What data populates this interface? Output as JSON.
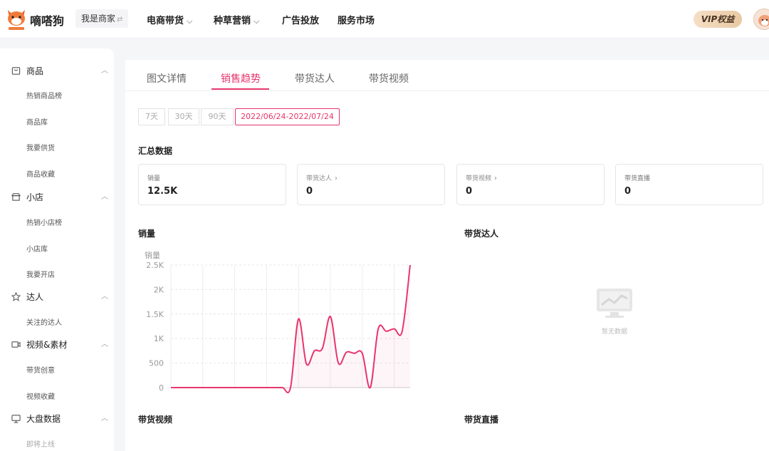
{
  "header": {
    "brand": "嘀嗒狗",
    "merchant_switch": "我是商家",
    "nav": [
      {
        "label": "电商带货",
        "has_dropdown": true
      },
      {
        "label": "种草营销",
        "has_dropdown": true
      },
      {
        "label": "广告投放",
        "has_dropdown": false
      },
      {
        "label": "服务市场",
        "has_dropdown": false
      }
    ],
    "vip_label": "VIP权益"
  },
  "sidebar": {
    "sections": [
      {
        "label": "商品",
        "icon": "shopping-bag-icon",
        "items": [
          "热销商品榜",
          "商品库",
          "我要供货",
          "商品收藏"
        ]
      },
      {
        "label": "小店",
        "icon": "store-icon",
        "items": [
          "热销小店榜",
          "小店库",
          "我要开店"
        ]
      },
      {
        "label": "达人",
        "icon": "star-icon",
        "items": [
          "关注的达人"
        ]
      },
      {
        "label": "视频&素材",
        "icon": "video-camera-icon",
        "items": [
          "带货创意",
          "视频收藏"
        ]
      },
      {
        "label": "大盘数据",
        "icon": "dashboard-icon",
        "items": [
          "即将上线"
        ]
      }
    ]
  },
  "tabs": [
    "图文详情",
    "销售趋势",
    "带货达人",
    "带货视频"
  ],
  "active_tab": "销售趋势",
  "date_ranges": [
    "7天",
    "30天",
    "90天",
    "2022/06/24-2022/07/24"
  ],
  "active_range": "2022/06/24-2022/07/24",
  "summary": {
    "title": "汇总数据",
    "cards": [
      {
        "label": "销量",
        "value": "12.5K",
        "link": false
      },
      {
        "label": "带货达人",
        "value": "0",
        "link": true
      },
      {
        "label": "带货视频",
        "value": "0",
        "link": true
      },
      {
        "label": "带货直播",
        "value": "0",
        "link": false
      }
    ]
  },
  "sections": {
    "sales": "销量",
    "influencers": "带货达人",
    "videos": "带货视频",
    "live": "带货直播"
  },
  "empty_state_text": "暂无数据",
  "colors": {
    "accent": "#e8356d",
    "vip_bg": "#f0d3b1"
  },
  "chart_data": {
    "type": "line",
    "title": "",
    "ylabel": "销量",
    "xlabel": "",
    "ylim": [
      0,
      2500
    ],
    "y_ticks": [
      "0",
      "500",
      "1K",
      "1.5K",
      "2K",
      "2.5K"
    ],
    "grid": true,
    "x": [
      1,
      2,
      3,
      4,
      5,
      6,
      7,
      8,
      9,
      10,
      11,
      12,
      13,
      14,
      15,
      16,
      17,
      18,
      19,
      20,
      21,
      22,
      23,
      24,
      25,
      26,
      27,
      28,
      29,
      30,
      31
    ],
    "values": [
      0,
      0,
      0,
      0,
      0,
      0,
      0,
      0,
      0,
      0,
      0,
      0,
      0,
      0,
      0,
      0,
      1400,
      480,
      750,
      800,
      1450,
      500,
      720,
      700,
      700,
      0,
      1200,
      1150,
      1200,
      1150,
      2500
    ]
  }
}
